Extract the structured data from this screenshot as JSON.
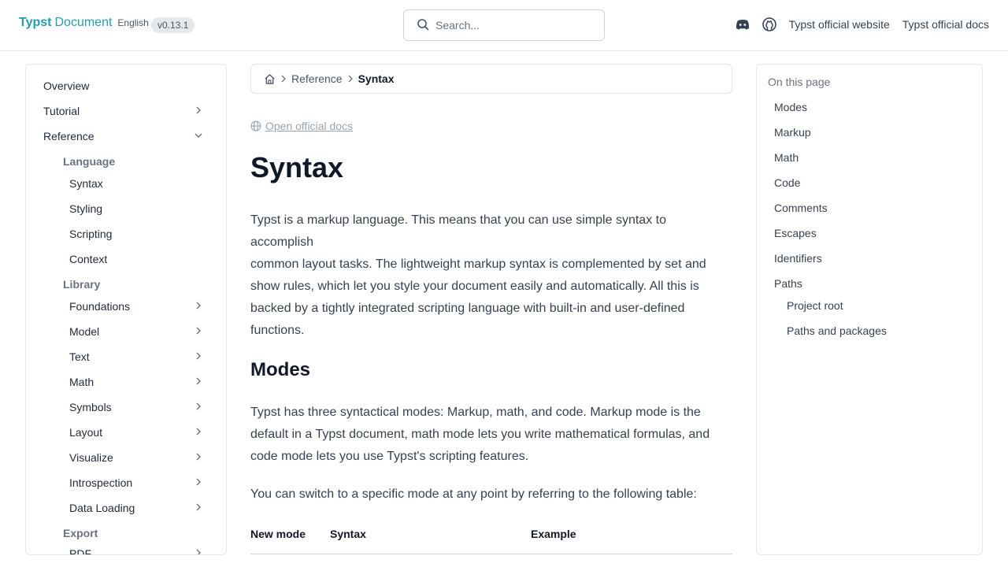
{
  "header": {
    "brand_typst": "Typst",
    "brand_document": "Document",
    "brand_language": "English",
    "version": "v0.13.1",
    "search_placeholder": "Search...",
    "link_website": "Typst official website",
    "link_docs": "Typst official docs",
    "icons": [
      "discord-icon",
      "github-icon",
      "search-icon"
    ]
  },
  "sidebar": {
    "top_items": [
      {
        "label": "Overview",
        "expandable": false
      },
      {
        "label": "Tutorial",
        "expandable": true,
        "expanded": false
      },
      {
        "label": "Reference",
        "expandable": true,
        "expanded": true
      }
    ],
    "groups": [
      {
        "label": "Language",
        "items": [
          "Syntax",
          "Styling",
          "Scripting",
          "Context"
        ]
      },
      {
        "label": "Library",
        "items": [
          "Foundations",
          "Model",
          "Text",
          "Math",
          "Symbols",
          "Layout",
          "Visualize",
          "Introspection",
          "Data Loading"
        ]
      },
      {
        "label": "Export",
        "items": [
          "PDF"
        ]
      }
    ]
  },
  "breadcrumb": {
    "items": [
      "Reference",
      "Syntax"
    ]
  },
  "main": {
    "open_docs": "Open official docs",
    "title": "Syntax",
    "intro": "Typst is a markup language. This means that you can use simple syntax to accomplish common layout tasks. The lightweight markup syntax is complemented by set and show rules, which let you style your document easily and automatically. All this is backed by a tightly integrated scripting language with built-in and user-defined functions.",
    "intro_lines": [
      "Typst is a markup language. This means that you can use simple syntax to accomplish",
      "common layout tasks. The lightweight markup syntax is complemented by set and",
      "show rules, which let you style your document easily and automatically. All this is",
      "backed by a tightly integrated scripting language with built-in and user-defined",
      "functions."
    ],
    "modes_heading": "Modes",
    "modes_lines": [
      "Typst has three syntactical modes: Markup, math, and code. Markup mode is the",
      "default in a Typst document, math mode lets you write mathematical formulas, and",
      "code mode lets you use Typst's scripting features."
    ],
    "switch_text": "You can switch to a specific mode at any point by referring to the following table:",
    "table_headers": [
      "New mode",
      "Syntax",
      "Example"
    ]
  },
  "toc": {
    "title": "On this page",
    "items": [
      "Modes",
      "Markup",
      "Math",
      "Code",
      "Comments",
      "Escapes",
      "Identifiers",
      "Paths"
    ],
    "subitems": [
      "Project root",
      "Paths and packages"
    ]
  },
  "colors": {
    "accent": "#239dad",
    "text": "#374151",
    "muted": "#6b7280",
    "border": "#e5e7eb"
  }
}
